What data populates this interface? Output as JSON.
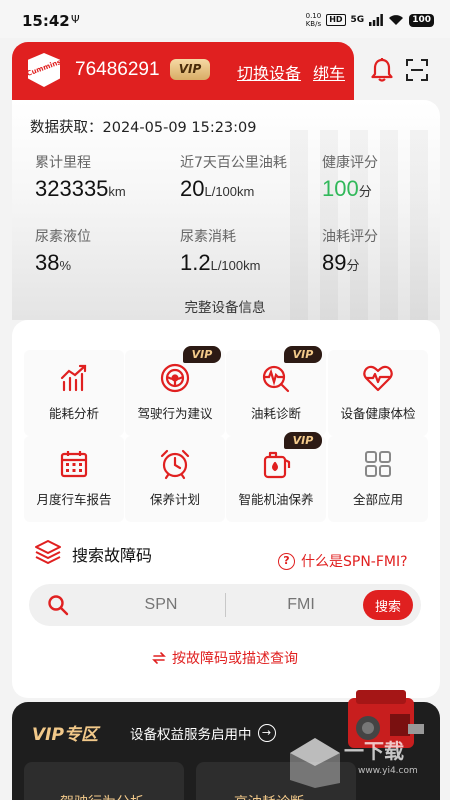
{
  "status_bar": {
    "time": "15:42",
    "speed_value": "0.10",
    "speed_unit": "KB/s",
    "hd": "HD",
    "network": "5G",
    "battery": "100"
  },
  "header": {
    "logo_text": "Cummins",
    "device_id": "76486291",
    "vip_badge": "VIP",
    "switch_device": "切换设备",
    "bind_car": "绑车"
  },
  "info": {
    "data_time": "数据获取：2024-05-09 15:23:09",
    "metrics": [
      {
        "label": "累计里程",
        "value": "323335",
        "unit": "km"
      },
      {
        "label": "近7天百公里油耗",
        "value": "20",
        "unit": "L/100km"
      },
      {
        "label": "健康评分",
        "value": "100",
        "unit": "分"
      },
      {
        "label": "尿素液位",
        "value": "38",
        "unit": "%"
      },
      {
        "label": "尿素消耗",
        "value": "1.2",
        "unit": "L/100km"
      },
      {
        "label": "油耗评分",
        "value": "89",
        "unit": "分"
      }
    ],
    "full_info": "完整设备信息"
  },
  "menu": {
    "items": [
      {
        "label": "能耗分析",
        "icon": "chart-trend-icon",
        "vip": ""
      },
      {
        "label": "驾驶行为建议",
        "icon": "steering-wheel-icon",
        "vip": "VIP"
      },
      {
        "label": "油耗诊断",
        "icon": "diagnosis-icon",
        "vip": "VIP"
      },
      {
        "label": "设备健康体检",
        "icon": "heart-pulse-icon",
        "vip": ""
      },
      {
        "label": "月度行车报告",
        "icon": "calendar-icon",
        "vip": ""
      },
      {
        "label": "保养计划",
        "icon": "alarm-clock-icon",
        "vip": ""
      },
      {
        "label": "智能机油保养",
        "icon": "oil-can-icon",
        "vip": "VIP"
      },
      {
        "label": "全部应用",
        "icon": "grid-icon",
        "vip": ""
      }
    ]
  },
  "fault_search": {
    "title": "搜索故障码",
    "help_link": "什么是SPN-FMI?",
    "spn_placeholder": "SPN",
    "fmi_placeholder": "FMI",
    "search_button": "搜索",
    "query_link": "按故障码或描述查询"
  },
  "vip_zone": {
    "title": "VIP专区",
    "subtitle": "设备权益服务启用中",
    "card1": "驾驶行为分析",
    "card2": "高油耗诊断",
    "watermark": "一下载",
    "watermark_url": "www.yi4.com"
  },
  "colors": {
    "brand_red": "#e02020",
    "vip_gold": "#f2c98a",
    "health_green": "#31b85a"
  }
}
